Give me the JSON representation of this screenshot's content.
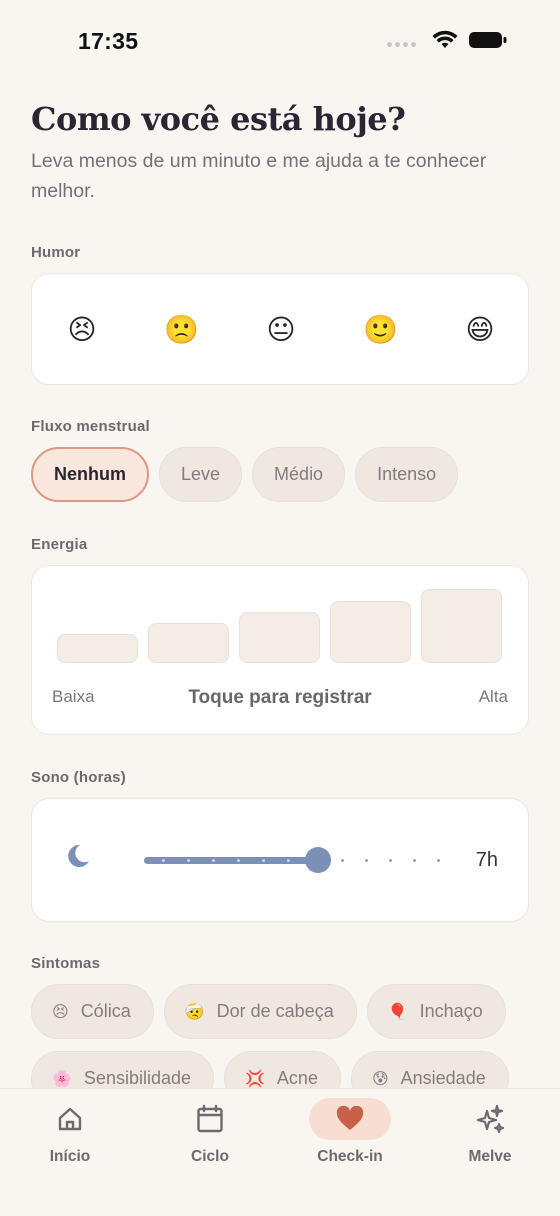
{
  "status_bar": {
    "time": "17:35",
    "icons": [
      "cellular-dots-icon",
      "wifi-icon",
      "battery-icon"
    ]
  },
  "header": {
    "title": "Como você está hoje?",
    "subtitle": "Leva menos de um minuto e me ajuda a te conhecer melhor."
  },
  "mood": {
    "label": "Humor",
    "options": [
      "😣",
      "🙁",
      "😐",
      "🙂",
      "😄"
    ]
  },
  "flow": {
    "label": "Fluxo menstrual",
    "options": [
      "Nenhum",
      "Leve",
      "Médio",
      "Intenso"
    ],
    "selected": "Nenhum"
  },
  "energy": {
    "label": "Energia",
    "low_label": "Baixa",
    "prompt": "Toque para registrar",
    "high_label": "Alta",
    "levels": 5
  },
  "sleep": {
    "label": "Sono (horas)",
    "value_text": "7h",
    "value_hours": 7
  },
  "symptoms": {
    "label": "Sintomas",
    "items": [
      {
        "emoji": "😣",
        "label": "Cólica"
      },
      {
        "emoji": "🤕",
        "label": "Dor de cabeça"
      },
      {
        "emoji": "🎈",
        "label": "Inchaço"
      },
      {
        "emoji": "🌸",
        "label": "Sensibilidade"
      },
      {
        "emoji": "💢",
        "label": "Acne"
      },
      {
        "emoji": "😰",
        "label": "Ansiedade"
      }
    ]
  },
  "tabbar": {
    "items": [
      {
        "label": "Início",
        "icon": "home-icon"
      },
      {
        "label": "Ciclo",
        "icon": "calendar-icon"
      },
      {
        "label": "Check-in",
        "icon": "heart-icon"
      },
      {
        "label": "Melve",
        "icon": "sparkles-icon"
      }
    ],
    "active": "Check-in"
  },
  "colors": {
    "background": "#f9f6f2",
    "accent": "#dd9884",
    "heart": "#c8614a",
    "slider": "#7b90b6"
  }
}
